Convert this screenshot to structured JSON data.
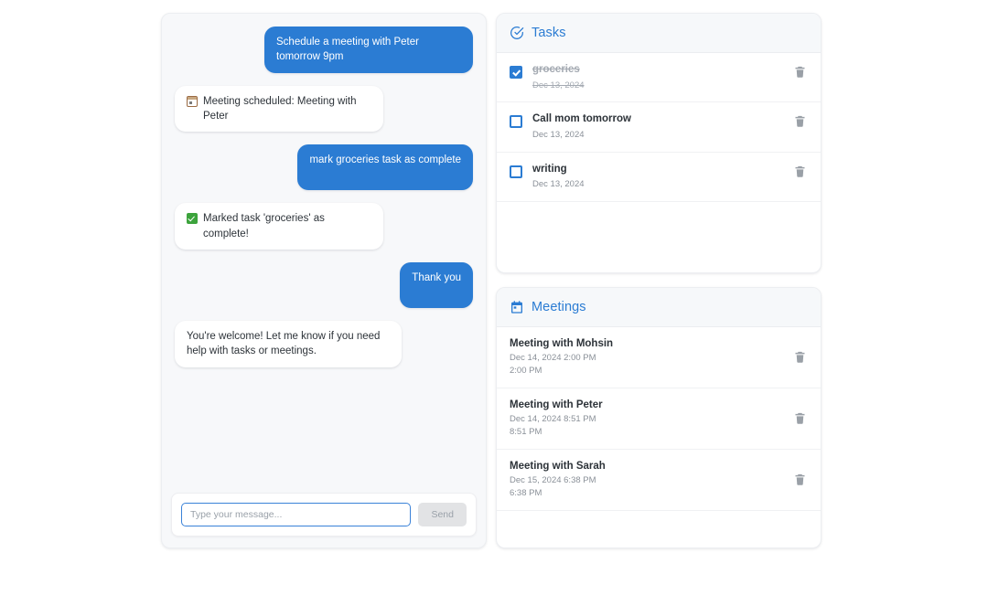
{
  "chat": {
    "messages": [
      {
        "role": "user",
        "text": "Schedule a meeting with Peter tomorrow 9pm",
        "emoji": ""
      },
      {
        "role": "bot",
        "text": "Meeting scheduled: Meeting with Peter",
        "emoji": "calendar-emoji"
      },
      {
        "role": "user",
        "text": "mark groceries task as complete",
        "emoji": ""
      },
      {
        "role": "bot",
        "text": "Marked task 'groceries' as complete!",
        "emoji": "white-check-mark-emoji"
      },
      {
        "role": "user",
        "text": "Thank you",
        "emoji": ""
      },
      {
        "role": "bot",
        "text": "You're welcome! Let me know if you need help with tasks or meetings.",
        "emoji": ""
      }
    ],
    "input": {
      "value": "",
      "placeholder": "Type your message...",
      "send_label": "Send"
    }
  },
  "tasks_panel": {
    "title": "Tasks",
    "icon": "check-circle-icon",
    "items": [
      {
        "title": "groceries",
        "date": "Dec 13, 2024",
        "completed": true,
        "delete_icon": "trash-icon"
      },
      {
        "title": "Call mom tomorrow",
        "date": "Dec 13, 2024",
        "completed": false,
        "delete_icon": "trash-icon"
      },
      {
        "title": "writing",
        "date": "Dec 13, 2024",
        "completed": false,
        "delete_icon": "trash-icon"
      }
    ]
  },
  "meetings_panel": {
    "title": "Meetings",
    "icon": "calendar-icon",
    "items": [
      {
        "title": "Meeting with Mohsin",
        "datetime": "Dec 14, 2024 2:00 PM",
        "time": "2:00 PM",
        "delete_icon": "trash-icon"
      },
      {
        "title": "Meeting with Peter",
        "datetime": "Dec 14, 2024 8:51 PM",
        "time": "8:51 PM",
        "delete_icon": "trash-icon"
      },
      {
        "title": "Meeting with Sarah",
        "datetime": "Dec 15, 2024 6:38 PM",
        "time": "6:38 PM",
        "delete_icon": "trash-icon"
      }
    ]
  },
  "colors": {
    "accent": "#2b7cd3",
    "user_bubble": "#2b7cd3",
    "bot_bubble": "#ffffff",
    "panel_header": "#f6f8fa",
    "chat_background": "#f7f8fa",
    "muted_text": "#8a9098"
  }
}
